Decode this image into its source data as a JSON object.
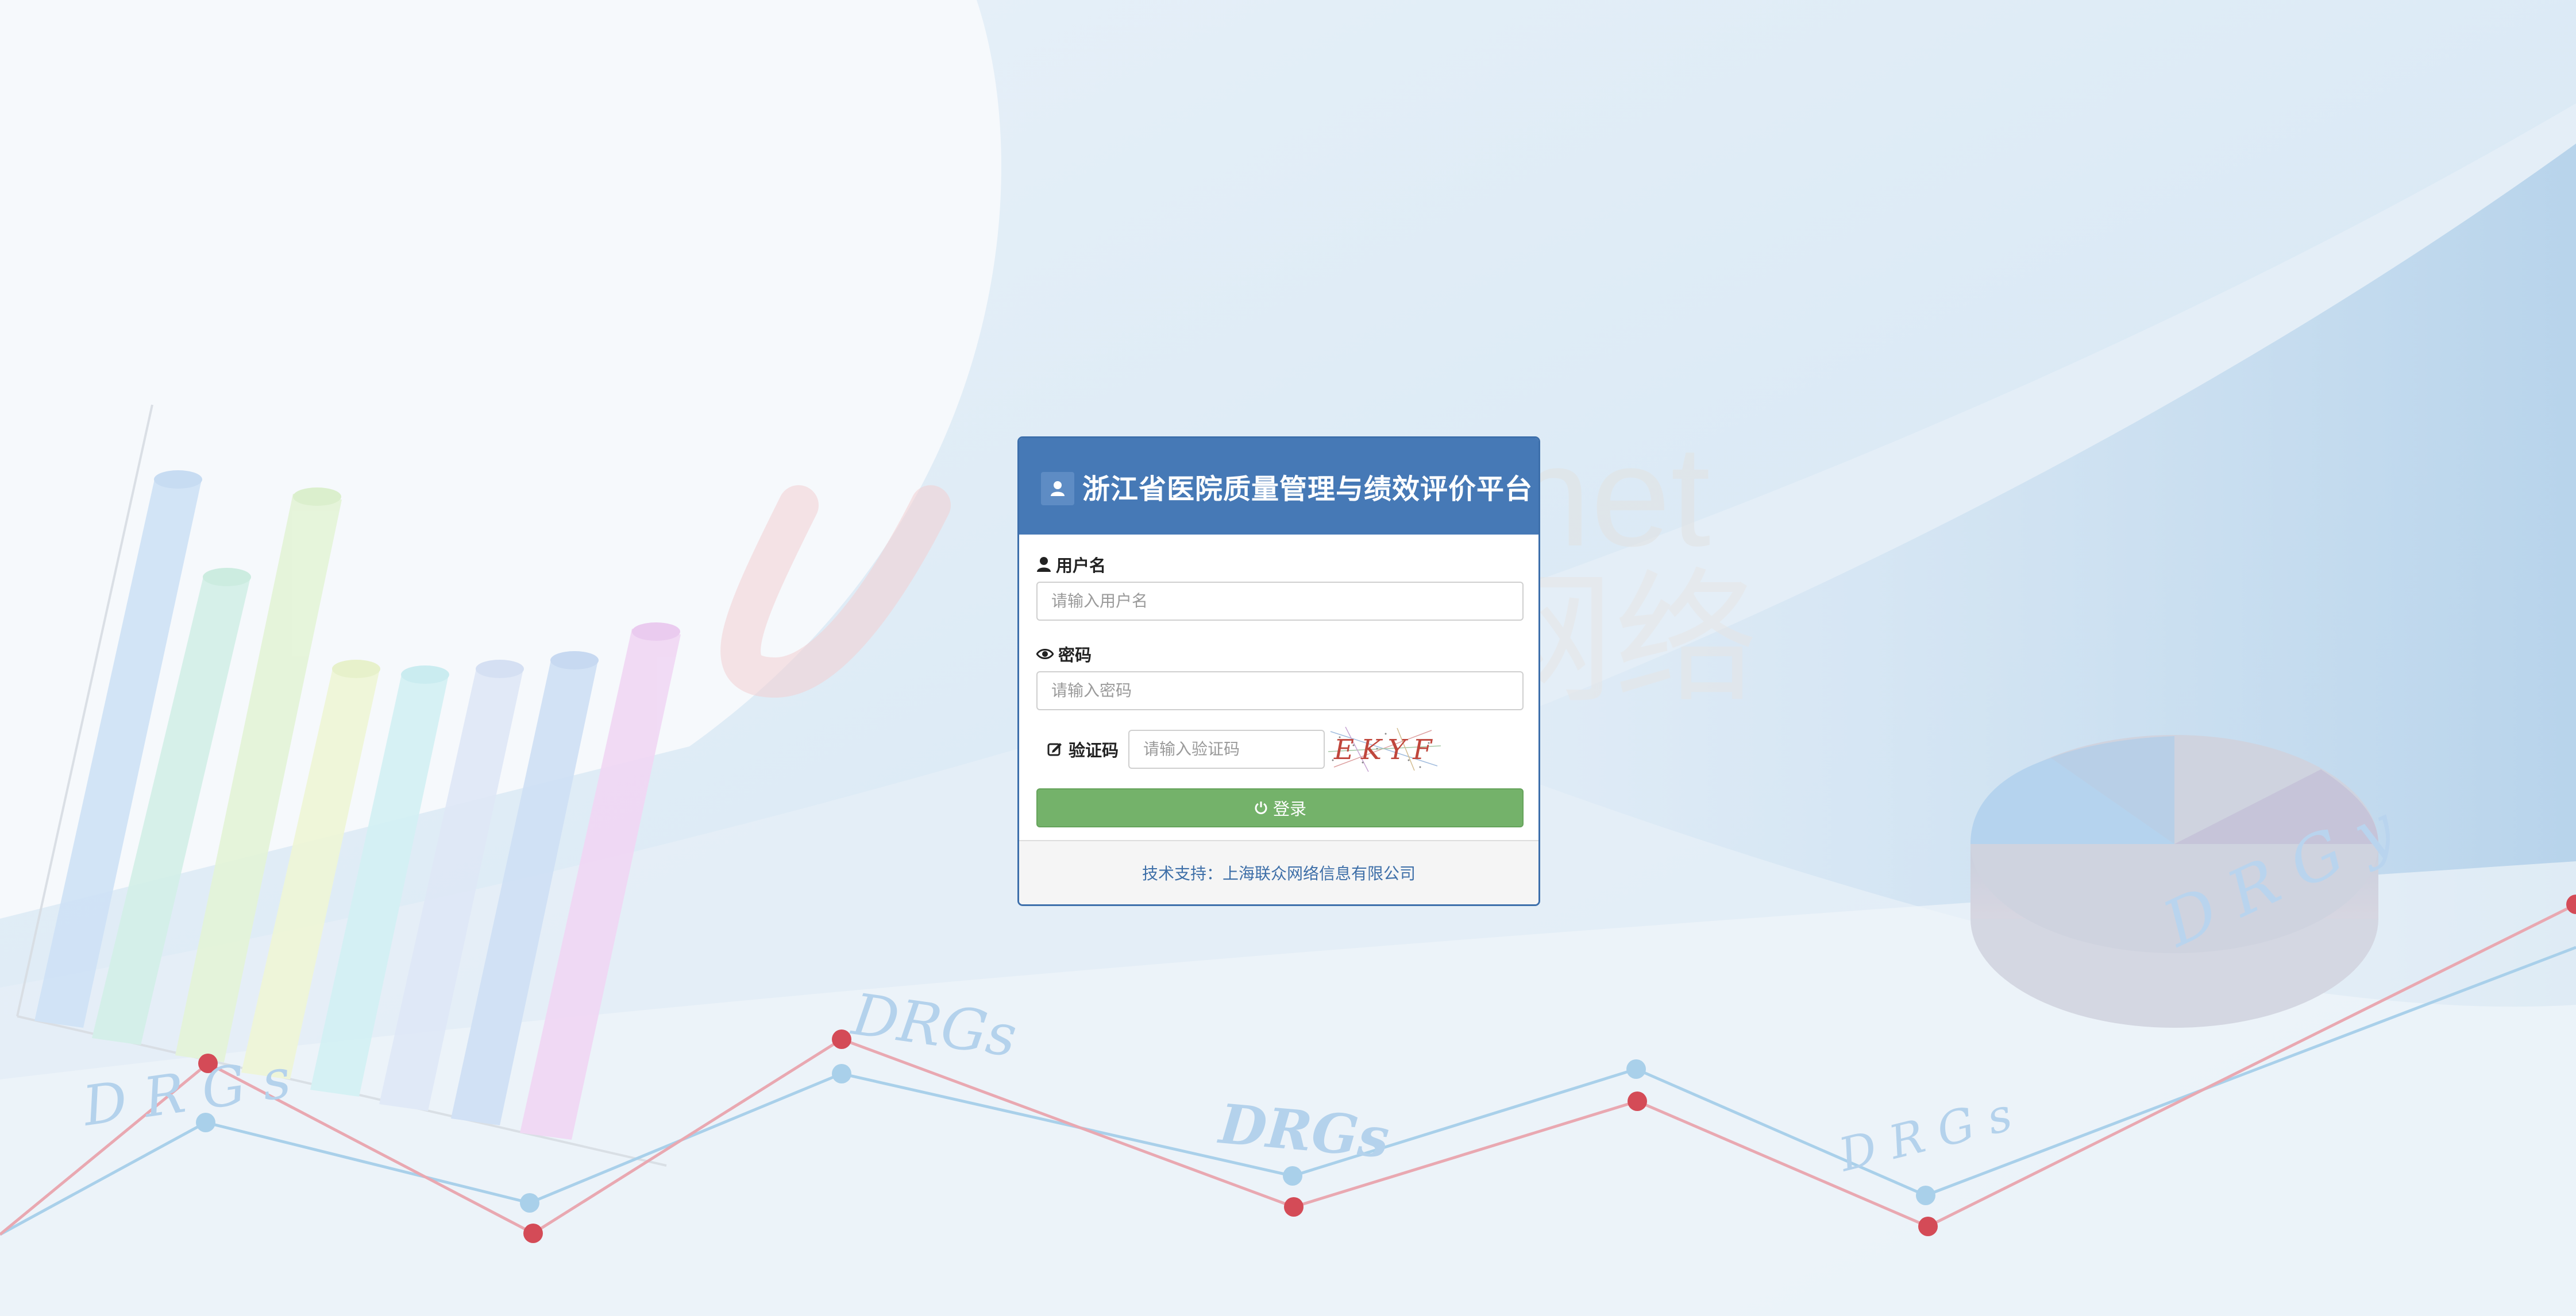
{
  "page": {
    "background_color": "#f4f8fc",
    "accent_color": "#4679b6",
    "button_color": "#74b26a"
  },
  "background": {
    "watermark_words": [
      "net",
      "网络"
    ],
    "drgs_labels": [
      "D R G s",
      "DRGs",
      "DRGs",
      "D R G s",
      "DRGs"
    ]
  },
  "login": {
    "header_icon": "user-icon",
    "title": "浙江省医院质量管理与绩效评价平台",
    "username": {
      "label": "用户名",
      "icon": "user-icon",
      "placeholder": "请输入用户名"
    },
    "password": {
      "label": "密码",
      "icon": "eye-icon",
      "placeholder": "请输入密码"
    },
    "captcha": {
      "label": "验证码",
      "icon": "edit-icon",
      "placeholder": "请输入验证码",
      "image_text": "EKYF"
    },
    "submit": {
      "label": "登录",
      "icon": "power-icon"
    },
    "footer": "技术支持：上海联众网络信息有限公司"
  }
}
